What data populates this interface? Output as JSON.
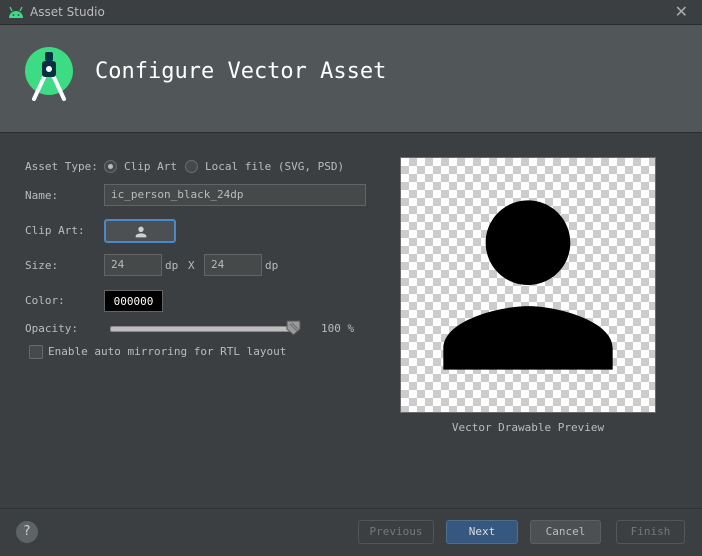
{
  "window": {
    "title": "Asset Studio",
    "close_glyph": "✕"
  },
  "header": {
    "title": "Configure Vector Asset"
  },
  "form": {
    "asset_type": {
      "label": "Asset Type:",
      "options": [
        "Clip Art",
        "Local file (SVG, PSD)"
      ],
      "selected": "Clip Art"
    },
    "name": {
      "label": "Name:",
      "value": "ic_person_black_24dp"
    },
    "clip_art": {
      "label": "Clip Art:",
      "icon": "person-icon"
    },
    "size": {
      "label": "Size:",
      "width": "24",
      "height": "24",
      "unit": "dp",
      "separator": "X"
    },
    "color": {
      "label": "Color:",
      "value": "000000"
    },
    "opacity": {
      "label": "Opacity:",
      "value": 100,
      "display": "100 %"
    },
    "auto_mirror": {
      "label": "Enable auto mirroring for RTL layout",
      "checked": false
    }
  },
  "preview": {
    "caption": "Vector Drawable Preview",
    "icon": "person-icon",
    "fill": "#000000"
  },
  "footer": {
    "help": "?",
    "previous": "Previous",
    "next": "Next",
    "cancel": "Cancel",
    "finish": "Finish"
  },
  "colors": {
    "accent": "#4a88c7",
    "primary_button": "#365880",
    "android_green": "#3ddc84"
  }
}
